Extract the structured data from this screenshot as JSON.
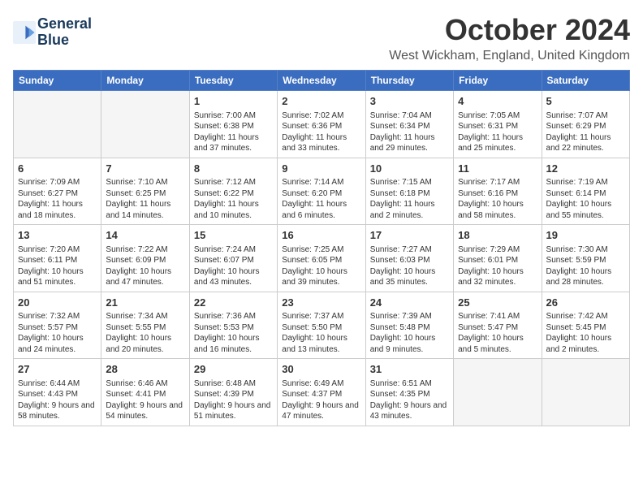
{
  "logo": {
    "line1": "General",
    "line2": "Blue"
  },
  "title": "October 2024",
  "location": "West Wickham, England, United Kingdom",
  "days_of_week": [
    "Sunday",
    "Monday",
    "Tuesday",
    "Wednesday",
    "Thursday",
    "Friday",
    "Saturday"
  ],
  "weeks": [
    [
      {
        "day": "",
        "sunrise": "",
        "sunset": "",
        "daylight": ""
      },
      {
        "day": "",
        "sunrise": "",
        "sunset": "",
        "daylight": ""
      },
      {
        "day": "1",
        "sunrise": "Sunrise: 7:00 AM",
        "sunset": "Sunset: 6:38 PM",
        "daylight": "Daylight: 11 hours and 37 minutes."
      },
      {
        "day": "2",
        "sunrise": "Sunrise: 7:02 AM",
        "sunset": "Sunset: 6:36 PM",
        "daylight": "Daylight: 11 hours and 33 minutes."
      },
      {
        "day": "3",
        "sunrise": "Sunrise: 7:04 AM",
        "sunset": "Sunset: 6:34 PM",
        "daylight": "Daylight: 11 hours and 29 minutes."
      },
      {
        "day": "4",
        "sunrise": "Sunrise: 7:05 AM",
        "sunset": "Sunset: 6:31 PM",
        "daylight": "Daylight: 11 hours and 25 minutes."
      },
      {
        "day": "5",
        "sunrise": "Sunrise: 7:07 AM",
        "sunset": "Sunset: 6:29 PM",
        "daylight": "Daylight: 11 hours and 22 minutes."
      }
    ],
    [
      {
        "day": "6",
        "sunrise": "Sunrise: 7:09 AM",
        "sunset": "Sunset: 6:27 PM",
        "daylight": "Daylight: 11 hours and 18 minutes."
      },
      {
        "day": "7",
        "sunrise": "Sunrise: 7:10 AM",
        "sunset": "Sunset: 6:25 PM",
        "daylight": "Daylight: 11 hours and 14 minutes."
      },
      {
        "day": "8",
        "sunrise": "Sunrise: 7:12 AM",
        "sunset": "Sunset: 6:22 PM",
        "daylight": "Daylight: 11 hours and 10 minutes."
      },
      {
        "day": "9",
        "sunrise": "Sunrise: 7:14 AM",
        "sunset": "Sunset: 6:20 PM",
        "daylight": "Daylight: 11 hours and 6 minutes."
      },
      {
        "day": "10",
        "sunrise": "Sunrise: 7:15 AM",
        "sunset": "Sunset: 6:18 PM",
        "daylight": "Daylight: 11 hours and 2 minutes."
      },
      {
        "day": "11",
        "sunrise": "Sunrise: 7:17 AM",
        "sunset": "Sunset: 6:16 PM",
        "daylight": "Daylight: 10 hours and 58 minutes."
      },
      {
        "day": "12",
        "sunrise": "Sunrise: 7:19 AM",
        "sunset": "Sunset: 6:14 PM",
        "daylight": "Daylight: 10 hours and 55 minutes."
      }
    ],
    [
      {
        "day": "13",
        "sunrise": "Sunrise: 7:20 AM",
        "sunset": "Sunset: 6:11 PM",
        "daylight": "Daylight: 10 hours and 51 minutes."
      },
      {
        "day": "14",
        "sunrise": "Sunrise: 7:22 AM",
        "sunset": "Sunset: 6:09 PM",
        "daylight": "Daylight: 10 hours and 47 minutes."
      },
      {
        "day": "15",
        "sunrise": "Sunrise: 7:24 AM",
        "sunset": "Sunset: 6:07 PM",
        "daylight": "Daylight: 10 hours and 43 minutes."
      },
      {
        "day": "16",
        "sunrise": "Sunrise: 7:25 AM",
        "sunset": "Sunset: 6:05 PM",
        "daylight": "Daylight: 10 hours and 39 minutes."
      },
      {
        "day": "17",
        "sunrise": "Sunrise: 7:27 AM",
        "sunset": "Sunset: 6:03 PM",
        "daylight": "Daylight: 10 hours and 35 minutes."
      },
      {
        "day": "18",
        "sunrise": "Sunrise: 7:29 AM",
        "sunset": "Sunset: 6:01 PM",
        "daylight": "Daylight: 10 hours and 32 minutes."
      },
      {
        "day": "19",
        "sunrise": "Sunrise: 7:30 AM",
        "sunset": "Sunset: 5:59 PM",
        "daylight": "Daylight: 10 hours and 28 minutes."
      }
    ],
    [
      {
        "day": "20",
        "sunrise": "Sunrise: 7:32 AM",
        "sunset": "Sunset: 5:57 PM",
        "daylight": "Daylight: 10 hours and 24 minutes."
      },
      {
        "day": "21",
        "sunrise": "Sunrise: 7:34 AM",
        "sunset": "Sunset: 5:55 PM",
        "daylight": "Daylight: 10 hours and 20 minutes."
      },
      {
        "day": "22",
        "sunrise": "Sunrise: 7:36 AM",
        "sunset": "Sunset: 5:53 PM",
        "daylight": "Daylight: 10 hours and 16 minutes."
      },
      {
        "day": "23",
        "sunrise": "Sunrise: 7:37 AM",
        "sunset": "Sunset: 5:50 PM",
        "daylight": "Daylight: 10 hours and 13 minutes."
      },
      {
        "day": "24",
        "sunrise": "Sunrise: 7:39 AM",
        "sunset": "Sunset: 5:48 PM",
        "daylight": "Daylight: 10 hours and 9 minutes."
      },
      {
        "day": "25",
        "sunrise": "Sunrise: 7:41 AM",
        "sunset": "Sunset: 5:47 PM",
        "daylight": "Daylight: 10 hours and 5 minutes."
      },
      {
        "day": "26",
        "sunrise": "Sunrise: 7:42 AM",
        "sunset": "Sunset: 5:45 PM",
        "daylight": "Daylight: 10 hours and 2 minutes."
      }
    ],
    [
      {
        "day": "27",
        "sunrise": "Sunrise: 6:44 AM",
        "sunset": "Sunset: 4:43 PM",
        "daylight": "Daylight: 9 hours and 58 minutes."
      },
      {
        "day": "28",
        "sunrise": "Sunrise: 6:46 AM",
        "sunset": "Sunset: 4:41 PM",
        "daylight": "Daylight: 9 hours and 54 minutes."
      },
      {
        "day": "29",
        "sunrise": "Sunrise: 6:48 AM",
        "sunset": "Sunset: 4:39 PM",
        "daylight": "Daylight: 9 hours and 51 minutes."
      },
      {
        "day": "30",
        "sunrise": "Sunrise: 6:49 AM",
        "sunset": "Sunset: 4:37 PM",
        "daylight": "Daylight: 9 hours and 47 minutes."
      },
      {
        "day": "31",
        "sunrise": "Sunrise: 6:51 AM",
        "sunset": "Sunset: 4:35 PM",
        "daylight": "Daylight: 9 hours and 43 minutes."
      },
      {
        "day": "",
        "sunrise": "",
        "sunset": "",
        "daylight": ""
      },
      {
        "day": "",
        "sunrise": "",
        "sunset": "",
        "daylight": ""
      }
    ]
  ]
}
